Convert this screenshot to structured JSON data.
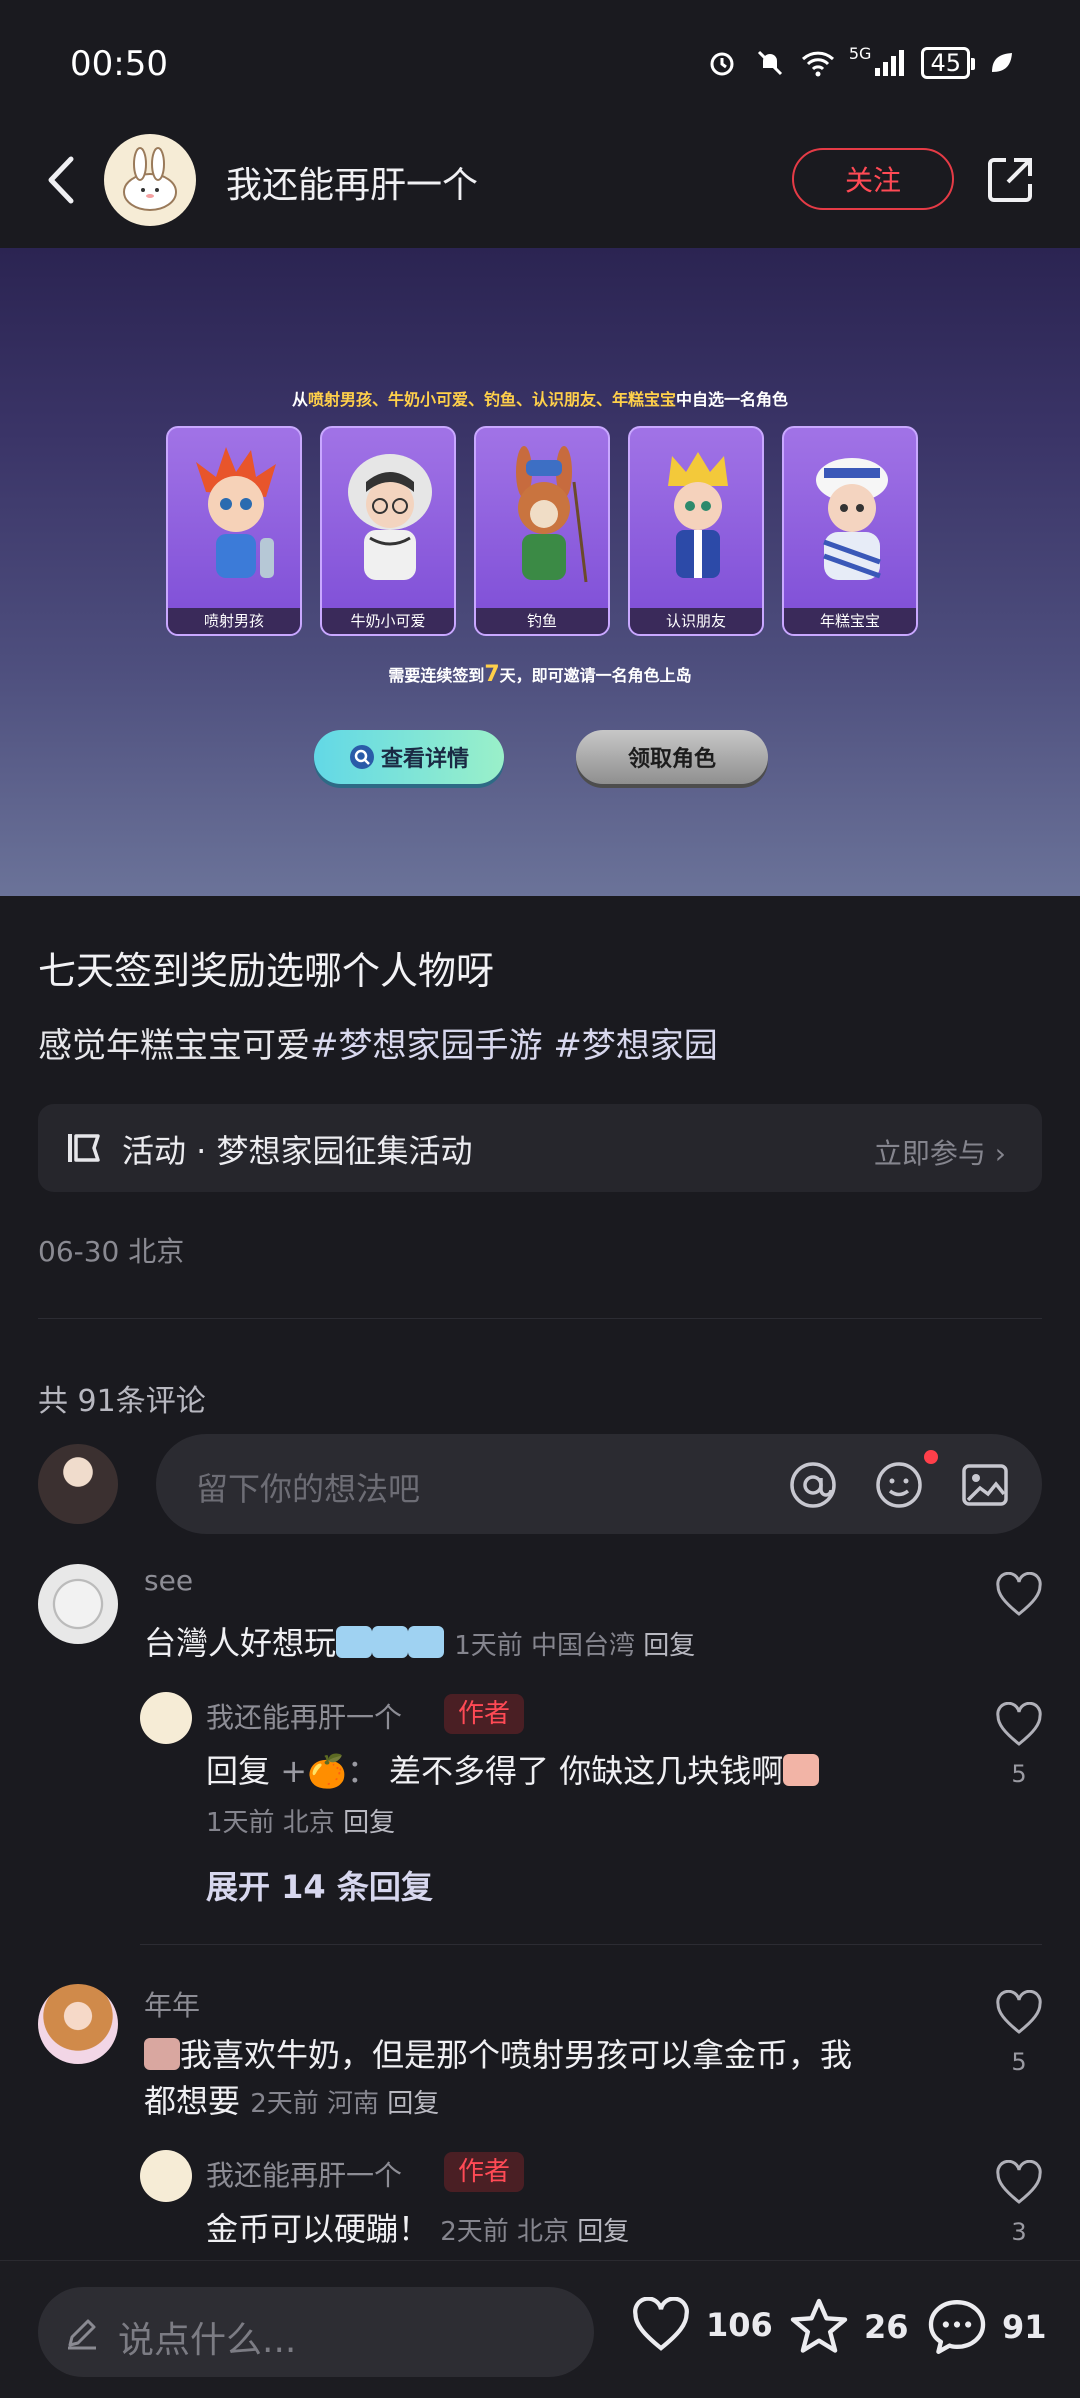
{
  "status": {
    "time": "00:50",
    "network": "5G",
    "battery": "45"
  },
  "header": {
    "title": "我还能再肝一个",
    "follow_label": "关注"
  },
  "hero": {
    "caption_pre": "从",
    "caption_names": "喷射男孩、牛奶小可爱、钓鱼、认识朋友、年糕宝宝",
    "caption_post": "中自选一名角色",
    "cards": [
      "喷射男孩",
      "牛奶小可爱",
      "钓鱼",
      "认识朋友",
      "年糕宝宝"
    ],
    "note_pre": "需要连续签到",
    "note_days": "7",
    "note_post": "天，即可邀请一名角色上岛",
    "details_btn": "查看详情",
    "claim_btn": "领取角色"
  },
  "post": {
    "title": "七天签到奖励选哪个人物呀",
    "text": "感觉年糕宝宝可爱",
    "tag1": "#梦想家园手游",
    "tag2": "#梦想家园",
    "activity_label": "活动 · 梦想家园征集活动",
    "activity_join": "立即参与 ›",
    "meta": "06-30 北京"
  },
  "comments_header": {
    "count_label": "共 91条评论",
    "input_placeholder": "留下你的想法吧"
  },
  "comments": [
    {
      "name": "see",
      "text": "台灣人好想玩",
      "time": "1天前",
      "location": "中国台湾",
      "reply_label": "回复",
      "replies": [
        {
          "name": "我还能再肝一个",
          "badge": "作者",
          "text_pre": "回复",
          "target": "+🍊：",
          "text": "差不多得了 你缺这几块钱啊",
          "time": "1天前",
          "location": "北京",
          "reply_label": "回复",
          "likes": "5"
        }
      ],
      "expand_label": "展开 14 条回复"
    },
    {
      "name": "年年",
      "text_line1": "我喜欢牛奶，但是那个喷射男孩可以拿金币，我",
      "text_line2": "都想要",
      "time": "2天前",
      "location": "河南",
      "reply_label": "回复",
      "likes": "5",
      "replies": [
        {
          "name": "我还能再肝一个",
          "badge": "作者",
          "text": "金币可以硬蹦！",
          "time": "2天前",
          "location": "北京",
          "reply_label": "回复",
          "likes": "3"
        }
      ]
    }
  ],
  "bottom_bar": {
    "input_placeholder": "说点什么...",
    "likes": "106",
    "favorites": "26",
    "comments": "91"
  },
  "colors": {
    "accent_red": "#ff4a55",
    "background": "#1a1a1f"
  }
}
